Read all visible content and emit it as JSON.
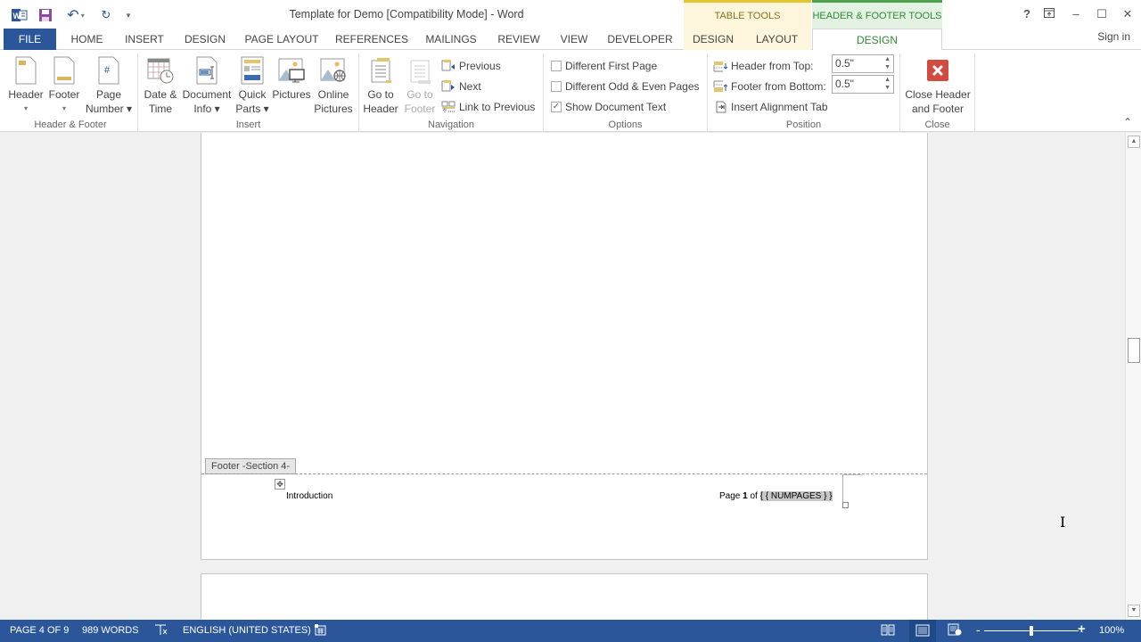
{
  "titlebar": {
    "title": "Template for Demo [Compatibility Mode] - Word",
    "qat": {
      "word_icon": "W",
      "save_icon": "save-icon",
      "undo_icon": "↶",
      "redo_icon": "↻",
      "customize_icon": "▾"
    },
    "context_groups": {
      "table_tools": "TABLE TOOLS",
      "hf_tools": "HEADER & FOOTER TOOLS"
    },
    "window": {
      "help": "?",
      "restore_ribbon": "⊼",
      "minimize": "–",
      "maximize": "☐",
      "close": "✕"
    }
  },
  "tabs": {
    "file": "FILE",
    "home": "HOME",
    "insert": "INSERT",
    "design": "DESIGN",
    "page_layout": "PAGE LAYOUT",
    "references": "REFERENCES",
    "mailings": "MAILINGS",
    "review": "REVIEW",
    "view": "VIEW",
    "developer": "DEVELOPER",
    "table_design": "DESIGN",
    "table_layout": "LAYOUT",
    "hf_design": "DESIGN",
    "sign_in": "Sign in"
  },
  "ribbon": {
    "groups": {
      "header_footer": {
        "label": "Header & Footer",
        "header": {
          "line1": "Header",
          "line2": "▾"
        },
        "footer": {
          "line1": "Footer",
          "line2": "▾"
        },
        "page_number": {
          "line1": "Page",
          "line2": "Number ▾"
        }
      },
      "insert": {
        "label": "Insert",
        "date_time": {
          "line1": "Date &",
          "line2": "Time"
        },
        "document_info": {
          "line1": "Document",
          "line2": "Info ▾"
        },
        "quick_parts": {
          "line1": "Quick",
          "line2": "Parts ▾"
        },
        "pictures": {
          "line1": "Pictures",
          "line2": ""
        },
        "online_pictures": {
          "line1": "Online",
          "line2": "Pictures"
        }
      },
      "navigation": {
        "label": "Navigation",
        "go_to_header": {
          "line1": "Go to",
          "line2": "Header"
        },
        "go_to_footer": {
          "line1": "Go to",
          "line2": "Footer"
        },
        "previous": "Previous",
        "next": "Next",
        "link_to_previous": "Link to Previous"
      },
      "options": {
        "label": "Options",
        "different_first_page": {
          "label": "Different First Page",
          "checked": false
        },
        "different_odd_even": {
          "label": "Different Odd & Even Pages",
          "checked": false
        },
        "show_document_text": {
          "label": "Show Document Text",
          "checked": true,
          "mark": "✓"
        }
      },
      "position": {
        "label": "Position",
        "header_from_top": {
          "label": "Header from Top:",
          "value": "0.5\""
        },
        "footer_from_bottom": {
          "label": "Footer from Bottom:",
          "value": "0.5\""
        },
        "insert_alignment_tab": "Insert Alignment Tab"
      },
      "close": {
        "label": "Close",
        "close_hf": {
          "line1": "Close Header",
          "line2": "and Footer"
        }
      }
    },
    "collapse_icon": "⌃"
  },
  "document": {
    "footer_tag": "Footer -Section 4-",
    "footer_left": "Introduction",
    "footer_right_prefix": "Page ",
    "footer_right_page": "1",
    "footer_right_of": " of ",
    "footer_right_field": "{ { NUMPAGES } }",
    "move_handle_icon": "✥"
  },
  "scrollbar": {
    "up": "▲",
    "down": "▼",
    "position_fraction": 0.44
  },
  "statusbar": {
    "page": "PAGE 4 OF 9",
    "words": "989 WORDS",
    "proofing_icon": "📖",
    "language": "ENGLISH (UNITED STATES)",
    "macro_icon": "▦",
    "view_read": "▤",
    "view_print": "▤",
    "view_web": "◩",
    "zoom_minus": "-",
    "zoom_plus": "+",
    "zoom_level": "100%",
    "zoom_fraction": 0.5
  },
  "cursor": {
    "ibeam": "I"
  }
}
